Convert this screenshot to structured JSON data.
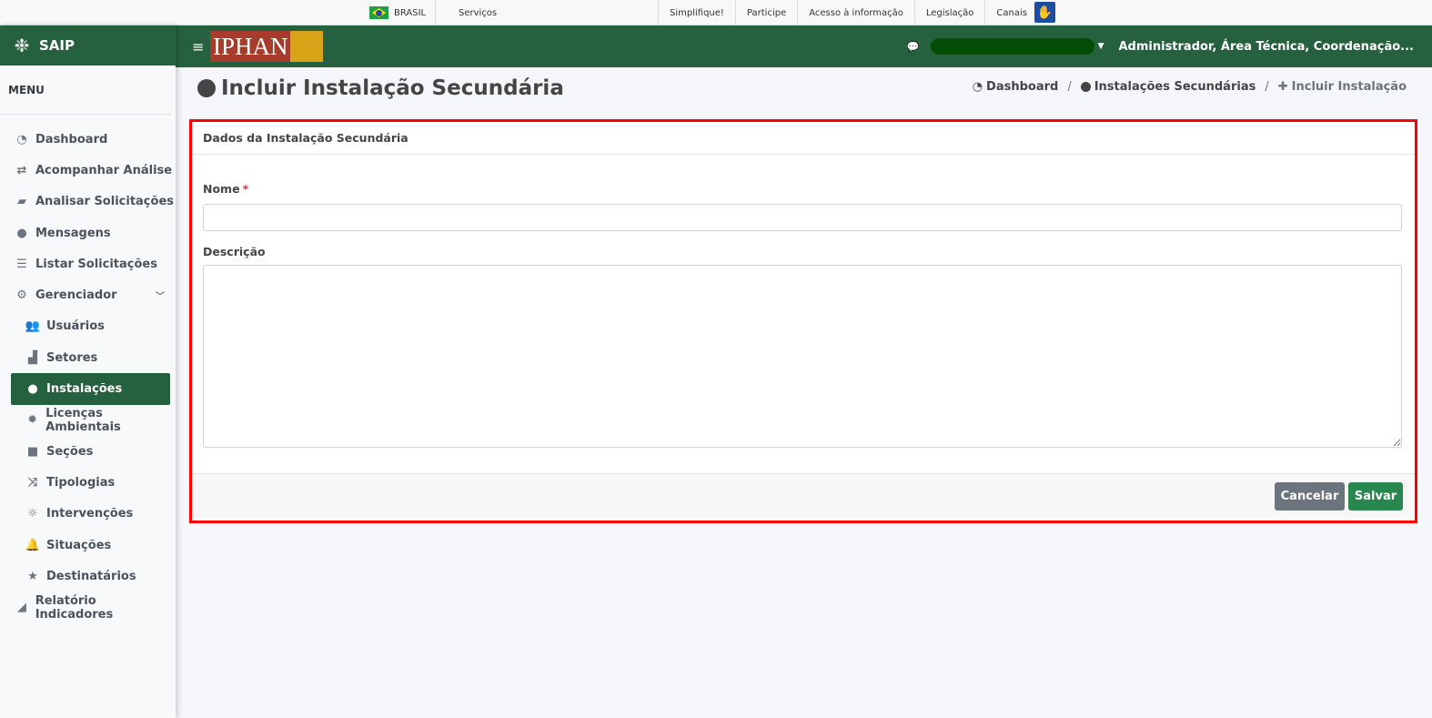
{
  "govbar": {
    "country": "BRASIL",
    "services": "Serviços",
    "links": [
      "Simplifique!",
      "Participe",
      "Acesso à informação",
      "Legislação",
      "Canais"
    ]
  },
  "sidebar": {
    "brand": "SAIP",
    "menu_title": "MENU",
    "items": [
      {
        "label": "Dashboard",
        "icon": "dashboard-icon"
      },
      {
        "label": "Acompanhar Análise",
        "icon": "exchange-icon"
      },
      {
        "label": "Analisar Solicitações",
        "icon": "book-icon"
      },
      {
        "label": "Mensagens",
        "icon": "comments-icon"
      },
      {
        "label": "Listar Solicitações",
        "icon": "list-icon"
      },
      {
        "label": "Gerenciador",
        "icon": "cogs-icon"
      },
      {
        "label": "Usuários",
        "icon": "users-icon"
      },
      {
        "label": "Setores",
        "icon": "industry-icon"
      },
      {
        "label": "Instalações",
        "icon": "circle-icon"
      },
      {
        "label": "Licenças Ambientais",
        "icon": "certificate-icon"
      },
      {
        "label": "Seções",
        "icon": "square-icon"
      },
      {
        "label": "Tipologias",
        "icon": "random-icon"
      },
      {
        "label": "Intervenções",
        "icon": "sun-icon"
      },
      {
        "label": "Situações",
        "icon": "bell-icon"
      },
      {
        "label": "Destinatários",
        "icon": "star-icon"
      },
      {
        "label": "Relatório Indicadores",
        "icon": "area-chart-icon"
      }
    ]
  },
  "topnav": {
    "logo_text": "IPHAN",
    "user": "Administrador, Área Técnica, Coordenação..."
  },
  "page": {
    "title": "Incluir Instalação Secundária",
    "breadcrumb": {
      "home": "Dashboard",
      "parent": "Instalações Secundárias",
      "current": "Incluir Instalação"
    }
  },
  "form": {
    "card_title": "Dados da Instalação Secundária",
    "nome_label": "Nome",
    "required_mark": "*",
    "nome_value": "",
    "descricao_label": "Descrição",
    "descricao_value": "",
    "cancel_label": "Cancelar",
    "save_label": "Salvar"
  },
  "colors": {
    "brand_green": "#25603f",
    "highlight_border": "#ff0000",
    "save_button": "#28874f",
    "cancel_button": "#6c757d"
  }
}
